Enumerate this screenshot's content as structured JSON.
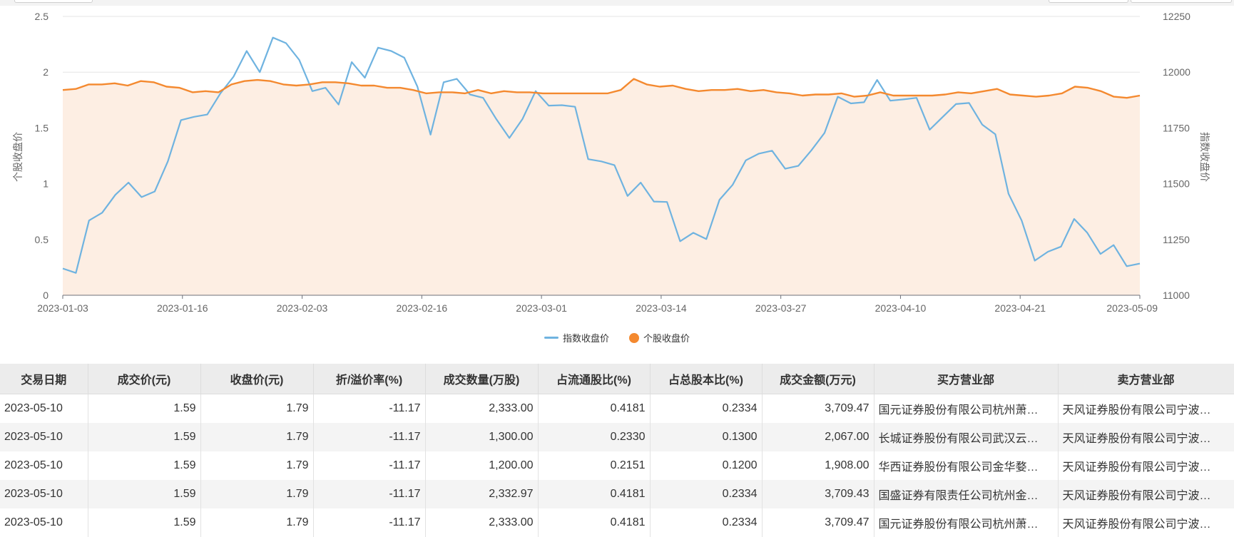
{
  "chart_data": {
    "type": "line",
    "x_ticks": [
      "2023-01-03",
      "2023-01-16",
      "2023-02-03",
      "2023-02-16",
      "2023-03-01",
      "2023-03-14",
      "2023-03-27",
      "2023-04-10",
      "2023-04-21",
      "2023-05-09"
    ],
    "y_left_label": "个股收盘价",
    "y_right_label": "指数收盘价",
    "y_left_ticks": [
      "0",
      "0.5",
      "1",
      "1.5",
      "2",
      "2.5"
    ],
    "y_right_ticks": [
      "11000",
      "11250",
      "11500",
      "11750",
      "12000",
      "12250"
    ],
    "y_left_range": [
      0,
      2.5
    ],
    "y_right_range": [
      11000,
      12250
    ],
    "legend_position": "bottom-center",
    "series": [
      {
        "name": "指数收盘价",
        "axis": "right",
        "color": "#6fb3e0",
        "style": "line",
        "values": [
          11120,
          11100,
          11335,
          11370,
          11450,
          11505,
          11440,
          11465,
          11600,
          11785,
          11800,
          11810,
          11905,
          11980,
          12095,
          12000,
          12155,
          12130,
          12055,
          11915,
          11930,
          11855,
          12045,
          11975,
          12110,
          12095,
          12065,
          11935,
          11720,
          11955,
          11970,
          11900,
          11885,
          11790,
          11705,
          11790,
          11915,
          11850,
          11852,
          11845,
          11610,
          11600,
          11583,
          11445,
          11505,
          11420,
          11418,
          11242,
          11280,
          11252,
          11428,
          11495,
          11605,
          11635,
          11648,
          11567,
          11580,
          11650,
          11728,
          11890,
          11860,
          11865,
          11965,
          11872,
          11878,
          11885,
          11742,
          11800,
          11857,
          11862,
          11765,
          11722,
          11455,
          11335,
          11155,
          11195,
          11218,
          11342,
          11280,
          11185,
          11225,
          11130,
          11142
        ]
      },
      {
        "name": "个股收盘价",
        "axis": "left",
        "color": "#f4892f",
        "style": "area",
        "values": [
          1.84,
          1.85,
          1.89,
          1.89,
          1.9,
          1.88,
          1.92,
          1.91,
          1.87,
          1.86,
          1.82,
          1.83,
          1.82,
          1.89,
          1.92,
          1.93,
          1.92,
          1.89,
          1.88,
          1.89,
          1.91,
          1.91,
          1.9,
          1.88,
          1.88,
          1.86,
          1.86,
          1.84,
          1.81,
          1.82,
          1.82,
          1.81,
          1.84,
          1.81,
          1.83,
          1.82,
          1.82,
          1.81,
          1.81,
          1.81,
          1.81,
          1.81,
          1.81,
          1.84,
          1.94,
          1.89,
          1.87,
          1.88,
          1.85,
          1.83,
          1.84,
          1.84,
          1.85,
          1.83,
          1.84,
          1.82,
          1.81,
          1.79,
          1.8,
          1.8,
          1.81,
          1.78,
          1.79,
          1.82,
          1.79,
          1.79,
          1.79,
          1.79,
          1.8,
          1.82,
          1.81,
          1.83,
          1.85,
          1.8,
          1.79,
          1.78,
          1.79,
          1.81,
          1.87,
          1.86,
          1.83,
          1.78,
          1.77,
          1.79
        ]
      }
    ]
  },
  "table": {
    "headers": [
      "交易日期",
      "成交价(元)",
      "收盘价(元)",
      "折/溢价率(%)",
      "成交数量(万股)",
      "占流通股比(%)",
      "占总股本比(%)",
      "成交金额(万元)",
      "买方营业部",
      "卖方营业部"
    ],
    "rows": [
      [
        "2023-05-10",
        "1.59",
        "1.79",
        "-11.17",
        "2,333.00",
        "0.4181",
        "0.2334",
        "3,709.47",
        "国元证券股份有限公司杭州萧…",
        "天风证券股份有限公司宁波…"
      ],
      [
        "2023-05-10",
        "1.59",
        "1.79",
        "-11.17",
        "1,300.00",
        "0.2330",
        "0.1300",
        "2,067.00",
        "长城证券股份有限公司武汉云…",
        "天风证券股份有限公司宁波…"
      ],
      [
        "2023-05-10",
        "1.59",
        "1.79",
        "-11.17",
        "1,200.00",
        "0.2151",
        "0.1200",
        "1,908.00",
        "华西证券股份有限公司金华婺…",
        "天风证券股份有限公司宁波…"
      ],
      [
        "2023-05-10",
        "1.59",
        "1.79",
        "-11.17",
        "2,332.97",
        "0.4181",
        "0.2334",
        "3,709.43",
        "国盛证券有限责任公司杭州金…",
        "天风证券股份有限公司宁波…"
      ],
      [
        "2023-05-10",
        "1.59",
        "1.79",
        "-11.17",
        "2,333.00",
        "0.4181",
        "0.2334",
        "3,709.47",
        "国元证券股份有限公司杭州萧…",
        "天风证券股份有限公司宁波…"
      ]
    ]
  }
}
